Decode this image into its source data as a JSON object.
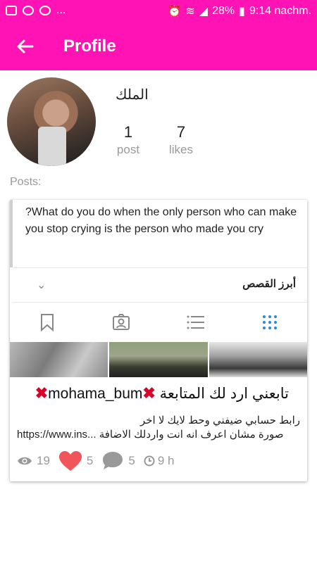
{
  "status_bar": {
    "dots": "...",
    "battery": "28%",
    "time": "9:14 nachm."
  },
  "app_bar": {
    "title": "Profile"
  },
  "profile": {
    "name": "الملك",
    "stats": [
      {
        "value": "1",
        "label": "post"
      },
      {
        "value": "7",
        "label": "likes"
      }
    ]
  },
  "posts_label": "Posts:",
  "card": {
    "bio": "?What do you do when the only person who can make you stop crying is the person who made you cry",
    "highlights_label": "أبرز القصص",
    "tabs": [
      {
        "icon": "bookmark-icon"
      },
      {
        "icon": "tagged-person-icon"
      },
      {
        "icon": "list-icon"
      },
      {
        "icon": "grid-icon",
        "active": true
      }
    ],
    "post": {
      "title_ar": "تابعني ارد لك المتابعة",
      "title_user": "mohama_bum",
      "body_line1": "رابط حسابي ضيفني وحط لايك لا اخر",
      "body_line2_link": "https://www.ins...",
      "body_line2_ar": "صورة مشان اعرف انه انت واردلك الاضافة",
      "views": "19",
      "likes": "5",
      "comments": "5",
      "time": "9 h"
    }
  },
  "colors": {
    "accent": "#ff13b5",
    "heart": "#f2545b",
    "x_mark": "#d9002a",
    "tab_active": "#2a8bd6"
  }
}
